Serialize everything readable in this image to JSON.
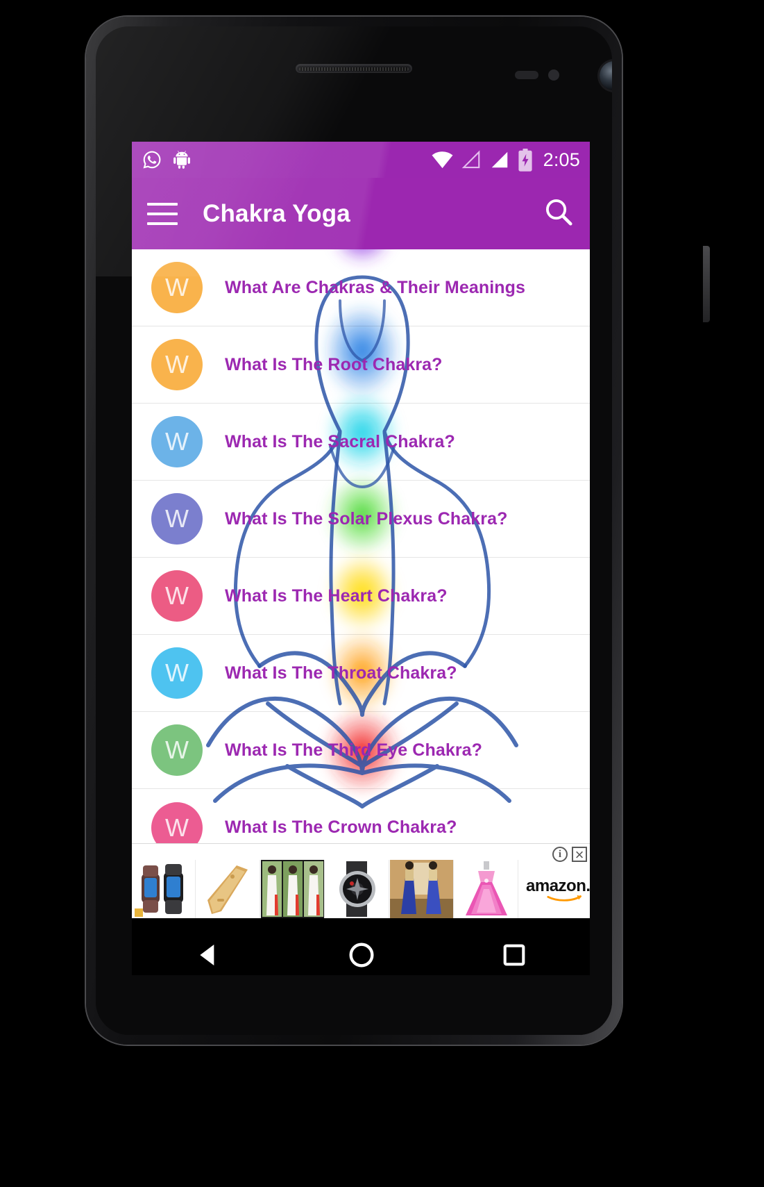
{
  "device": {
    "platform": "android-phone-mockup",
    "hardware": {
      "earpiece": "speaker-grille",
      "front_camera": "camera-lens",
      "proximity_sensor": "sensor",
      "power_button": "power-button",
      "volume_button": "volume-button"
    }
  },
  "statusbar": {
    "background": "#9b27b0",
    "time": "2:05",
    "left_icons": [
      {
        "name": "whatsapp-icon",
        "label": "WhatsApp"
      },
      {
        "name": "android-icon",
        "label": "Android"
      }
    ],
    "right_icons": [
      {
        "name": "wifi-icon",
        "label": "Wi-Fi"
      },
      {
        "name": "signal-empty-icon",
        "label": "Signal SIM 1"
      },
      {
        "name": "signal-full-icon",
        "label": "Signal SIM 2"
      },
      {
        "name": "battery-charging-icon",
        "label": "Battery charging"
      }
    ]
  },
  "appbar": {
    "background": "#9c27b0",
    "title": "Chakra Yoga",
    "menu_label": "Open navigation drawer",
    "search_label": "Search"
  },
  "list": {
    "accent_text_color": "#9c28b1",
    "avatar_letter": "W",
    "items": [
      {
        "label": "What Are Chakras & Their Meanings",
        "avatar_color": "#f9b34c"
      },
      {
        "label": "What Is The Root Chakra?",
        "avatar_color": "#f9b34c"
      },
      {
        "label": "What Is The Sacral Chakra?",
        "avatar_color": "#6cb3e8"
      },
      {
        "label": "What Is The Solar Plexus Chakra?",
        "avatar_color": "#7b7fce"
      },
      {
        "label": "What Is The Heart Chakra?",
        "avatar_color": "#ec5c84"
      },
      {
        "label": "What Is The Throat Chakra?",
        "avatar_color": "#4ec3f0"
      },
      {
        "label": "What Is The Third Eye Chakra?",
        "avatar_color": "#7cc47f"
      },
      {
        "label": "What Is The Crown Chakra?",
        "avatar_color": "#ec5c92"
      }
    ]
  },
  "background_art": {
    "name": "meditating-figure-chakras",
    "chakra_colors": [
      "#8b2be2",
      "#1f7ae0",
      "#19d3e8",
      "#3fd42a",
      "#ffe000",
      "#ff9800",
      "#ef1010"
    ],
    "outline_color": "#2d55a8"
  },
  "ad": {
    "advertiser": "amazon.in",
    "thumbnails": [
      {
        "name": "smartwatch"
      },
      {
        "name": "phone-case"
      },
      {
        "name": "dress-collage"
      },
      {
        "name": "wristwatch"
      },
      {
        "name": "lehenga"
      },
      {
        "name": "gown"
      }
    ],
    "info_label": "i",
    "close_label": "×"
  },
  "navbar": {
    "background": "#000000",
    "buttons": [
      {
        "name": "back-button",
        "label": "Back"
      },
      {
        "name": "home-button",
        "label": "Home"
      },
      {
        "name": "recents-button",
        "label": "Recent apps"
      }
    ]
  }
}
